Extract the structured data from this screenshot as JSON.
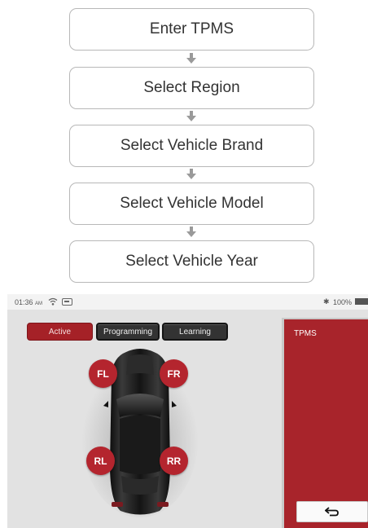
{
  "flowchart": {
    "steps": [
      {
        "label": "Enter TPMS"
      },
      {
        "label": "Select Region"
      },
      {
        "label": "Select Vehicle Brand"
      },
      {
        "label": "Select Vehicle Model"
      },
      {
        "label": "Select Vehicle Year"
      }
    ],
    "arrow_icon": "down-arrow-icon"
  },
  "device_screen": {
    "status_bar": {
      "time": "01:36",
      "ampm": "AM",
      "battery": "100%",
      "icons": [
        "wifi-icon",
        "app-icon",
        "bluetooth-icon",
        "battery-icon"
      ]
    },
    "tabs": [
      {
        "label": "Active",
        "active": true
      },
      {
        "label": "Programming",
        "active": false
      },
      {
        "label": "Learning",
        "active": false
      }
    ],
    "tires": {
      "fl": "FL",
      "fr": "FR",
      "rl": "RL",
      "rr": "RR"
    },
    "side_panel": {
      "title": "TPMS",
      "back_icon": "return-arrow-icon"
    },
    "colors": {
      "accent": "#a8242b",
      "tire_marker": "#b4252e",
      "tab_dark": "#333333",
      "screen_bg": "#e2e2e2"
    }
  }
}
